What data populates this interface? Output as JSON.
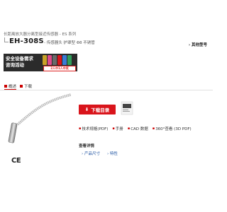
{
  "header": {
    "series_path": "长距离放大器分离型接近传感器 - ES 系列",
    "model": "EH-308S",
    "description": "- 传感器头 护罩型 Φ8 不锈管",
    "other_models": "› 其他型号"
  },
  "banner": {
    "line1": "安全设备需求",
    "line2": "咨询活动",
    "pill": "2人中1人中奖"
  },
  "tabs": [
    {
      "label": "概述"
    },
    {
      "label": "下载"
    }
  ],
  "download_button": {
    "label": "下载目录"
  },
  "links": [
    {
      "label": "技术规格(PDF)",
      "icon": "document-icon"
    },
    {
      "label": "手册",
      "icon": "book-icon"
    },
    {
      "label": "CAD 数据",
      "icon": "cad-icon"
    },
    {
      "label": "360°查看 (3D PDF)",
      "icon": "3d-icon"
    }
  ],
  "details": {
    "title": "查看详情",
    "links": [
      {
        "label": "› 产品尺寸"
      },
      {
        "label": "› 特性"
      }
    ]
  },
  "certification": "CE",
  "colors": {
    "accent": "#d9141b",
    "banner_bg": "#2b2b2b",
    "link": "#1a50a0"
  }
}
